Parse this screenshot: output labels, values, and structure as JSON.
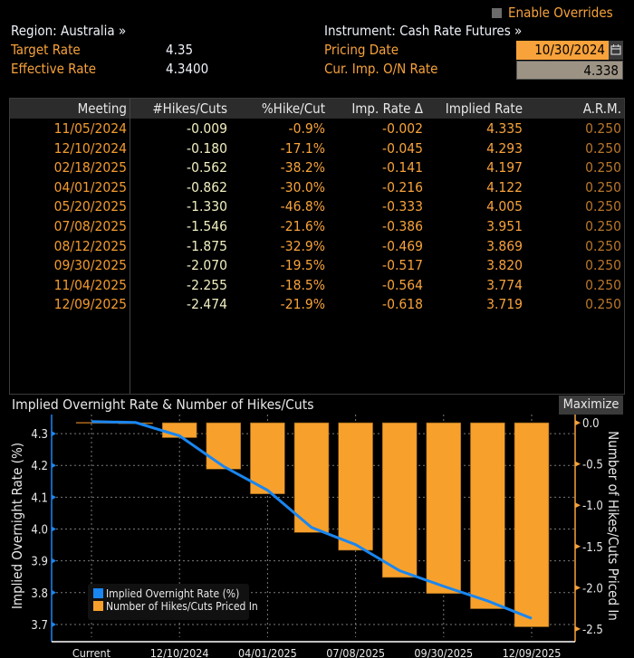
{
  "header": {
    "enable_overrides_label": "Enable Overrides",
    "enable_overrides_checked": false,
    "region_label": "Region: Australia »",
    "instrument_label": "Instrument: Cash Rate Futures »",
    "target_rate_label": "Target Rate",
    "target_rate_value": "4.35",
    "effective_rate_label": "Effective Rate",
    "effective_rate_value": "4.3400",
    "pricing_date_label": "Pricing Date",
    "pricing_date_value": "10/30/2024",
    "cur_imp_rate_label": "Cur. Imp. O/N Rate",
    "cur_imp_rate_value": "4.338"
  },
  "table": {
    "columns": [
      "Meeting",
      "#Hikes/Cuts",
      "%Hike/Cut",
      "Imp. Rate Δ",
      "Implied Rate",
      "A.R.M."
    ],
    "rows": [
      {
        "meeting": "11/05/2024",
        "hikes": "-0.009",
        "pct": "-0.9%",
        "delta": "-0.002",
        "rate": "4.335",
        "arm": "0.250"
      },
      {
        "meeting": "12/10/2024",
        "hikes": "-0.180",
        "pct": "-17.1%",
        "delta": "-0.045",
        "rate": "4.293",
        "arm": "0.250"
      },
      {
        "meeting": "02/18/2025",
        "hikes": "-0.562",
        "pct": "-38.2%",
        "delta": "-0.141",
        "rate": "4.197",
        "arm": "0.250"
      },
      {
        "meeting": "04/01/2025",
        "hikes": "-0.862",
        "pct": "-30.0%",
        "delta": "-0.216",
        "rate": "4.122",
        "arm": "0.250"
      },
      {
        "meeting": "05/20/2025",
        "hikes": "-1.330",
        "pct": "-46.8%",
        "delta": "-0.333",
        "rate": "4.005",
        "arm": "0.250"
      },
      {
        "meeting": "07/08/2025",
        "hikes": "-1.546",
        "pct": "-21.6%",
        "delta": "-0.386",
        "rate": "3.951",
        "arm": "0.250"
      },
      {
        "meeting": "08/12/2025",
        "hikes": "-1.875",
        "pct": "-32.9%",
        "delta": "-0.469",
        "rate": "3.869",
        "arm": "0.250"
      },
      {
        "meeting": "09/30/2025",
        "hikes": "-2.070",
        "pct": "-19.5%",
        "delta": "-0.517",
        "rate": "3.820",
        "arm": "0.250"
      },
      {
        "meeting": "11/04/2025",
        "hikes": "-2.255",
        "pct": "-18.5%",
        "delta": "-0.564",
        "rate": "3.774",
        "arm": "0.250"
      },
      {
        "meeting": "12/09/2025",
        "hikes": "-2.474",
        "pct": "-21.9%",
        "delta": "-0.618",
        "rate": "3.719",
        "arm": "0.250"
      }
    ]
  },
  "chart_panel": {
    "title": "Implied Overnight Rate & Number of Hikes/Cuts",
    "maximize_label": "Maximize"
  },
  "chart_data": {
    "type": "bar+line",
    "title": "Implied Overnight Rate & Number of Hikes/Cuts",
    "categories": [
      "Current",
      "11/05/2024",
      "12/10/2024",
      "02/18/2025",
      "04/01/2025",
      "05/20/2025",
      "07/08/2025",
      "08/12/2025",
      "09/30/2025",
      "11/04/2025",
      "12/09/2025"
    ],
    "x_tick_labels": [
      "Current",
      "12/10/2024",
      "04/01/2025",
      "07/08/2025",
      "09/30/2025",
      "12/09/2025"
    ],
    "series": [
      {
        "name": "Implied Overnight Rate (%)",
        "type": "line",
        "axis": "left",
        "color": "#1a86f0",
        "values": [
          4.338,
          4.335,
          4.293,
          4.197,
          4.122,
          4.005,
          3.951,
          3.869,
          3.82,
          3.774,
          3.719
        ]
      },
      {
        "name": "Number of Hikes/Cuts Priced In",
        "type": "bar",
        "axis": "right",
        "color": "#f7a12c",
        "values": [
          0,
          -0.009,
          -0.18,
          -0.562,
          -0.862,
          -1.33,
          -1.546,
          -1.875,
          -2.07,
          -2.255,
          -2.474
        ]
      }
    ],
    "ylabel": "Implied Overnight Rate (%)",
    "ylim": [
      3.66,
      4.36
    ],
    "yticks": [
      3.7,
      3.8,
      3.9,
      4.0,
      4.1,
      4.2,
      4.3
    ],
    "y2label": "Number of Hikes/Cuts Priced In",
    "y2lim": [
      -2.6,
      0.1
    ],
    "y2ticks": [
      0.0,
      -0.5,
      -1.0,
      -1.5,
      -2.0,
      -2.5
    ],
    "grid": true,
    "legend": "bottom-left"
  }
}
